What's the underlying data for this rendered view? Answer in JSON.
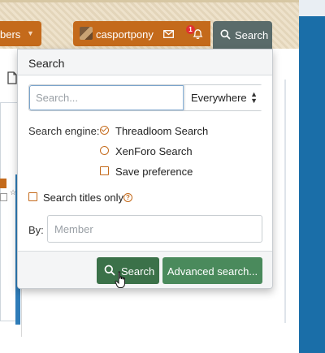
{
  "nav": {
    "members_label": "bers",
    "username": "casportpony",
    "alerts_count": "1",
    "search_label": "Search"
  },
  "dropdown": {
    "title": "Search",
    "search_placeholder": "Search...",
    "scope_value": "Everywhere",
    "engine_label": "Search engine:",
    "engine_options": [
      {
        "label": "Threadloom Search",
        "selected": true
      },
      {
        "label": "XenForo Search",
        "selected": false
      }
    ],
    "save_preference_label": "Save preference",
    "titles_only_label": "Search titles only",
    "by_label": "By:",
    "member_placeholder": "Member",
    "search_button": "Search",
    "advanced_button": "Advanced search..."
  },
  "colors": {
    "nav_orange": "#c46a1b",
    "nav_search_bg": "#5a6b6a",
    "button_green": "#3b7149",
    "accent_blue": "#1a6ea8"
  },
  "icons": [
    "chevron-down-icon",
    "avatar",
    "envelope-icon",
    "bell-icon",
    "search-icon",
    "help-icon",
    "hand-cursor-icon"
  ]
}
